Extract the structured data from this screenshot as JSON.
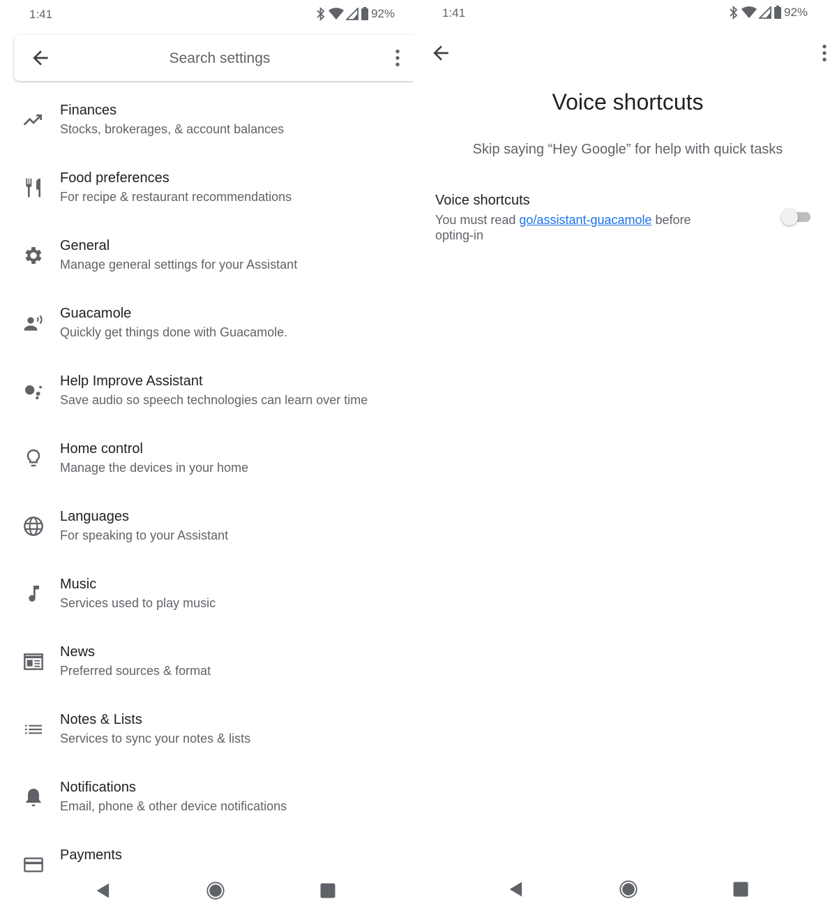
{
  "left_screen": {
    "status": {
      "time": "1:41",
      "battery": "92%"
    },
    "search": {
      "placeholder": "Search settings",
      "back_icon": "arrow-back-icon",
      "more_icon": "more-vert-icon"
    },
    "items": [
      {
        "title": "Finances",
        "subtitle": "Stocks, brokerages, & account balances",
        "icon": "trending-up-icon"
      },
      {
        "title": "Food preferences",
        "subtitle": "For recipe & restaurant recommendations",
        "icon": "restaurant-icon"
      },
      {
        "title": "General",
        "subtitle": "Manage general settings for your Assistant",
        "icon": "gear-icon"
      },
      {
        "title": "Guacamole",
        "subtitle": "Quickly get things done with Guacamole.",
        "icon": "voice-person-icon"
      },
      {
        "title": "Help Improve Assistant",
        "subtitle": "Save audio so speech technologies can learn over time",
        "icon": "assistant-dots-icon"
      },
      {
        "title": "Home control",
        "subtitle": "Manage the devices in your home",
        "icon": "lightbulb-icon"
      },
      {
        "title": "Languages",
        "subtitle": "For speaking to your Assistant",
        "icon": "globe-icon"
      },
      {
        "title": "Music",
        "subtitle": "Services used to play music",
        "icon": "music-note-icon"
      },
      {
        "title": "News",
        "subtitle": "Preferred sources & format",
        "icon": "newspaper-icon"
      },
      {
        "title": "Notes & Lists",
        "subtitle": "Services to sync your notes & lists",
        "icon": "list-icon"
      },
      {
        "title": "Notifications",
        "subtitle": "Email, phone & other device notifications",
        "icon": "bell-icon"
      },
      {
        "title": "Payments",
        "subtitle": "",
        "icon": "credit-card-icon"
      }
    ]
  },
  "right_screen": {
    "status": {
      "time": "1:41",
      "battery": "92%"
    },
    "title": "Voice shortcuts",
    "description": "Skip saying “Hey Google” for help with quick tasks",
    "preference": {
      "title": "Voice shortcuts",
      "summary_prefix": "You must read ",
      "link_text": "go/assistant-guacamole",
      "summary_suffix": " before opting-in",
      "toggle_on": false
    }
  },
  "colors": {
    "text_primary": "#202124",
    "text_secondary": "#5f6368",
    "link": "#1a73e8",
    "icon": "#5f6368"
  }
}
